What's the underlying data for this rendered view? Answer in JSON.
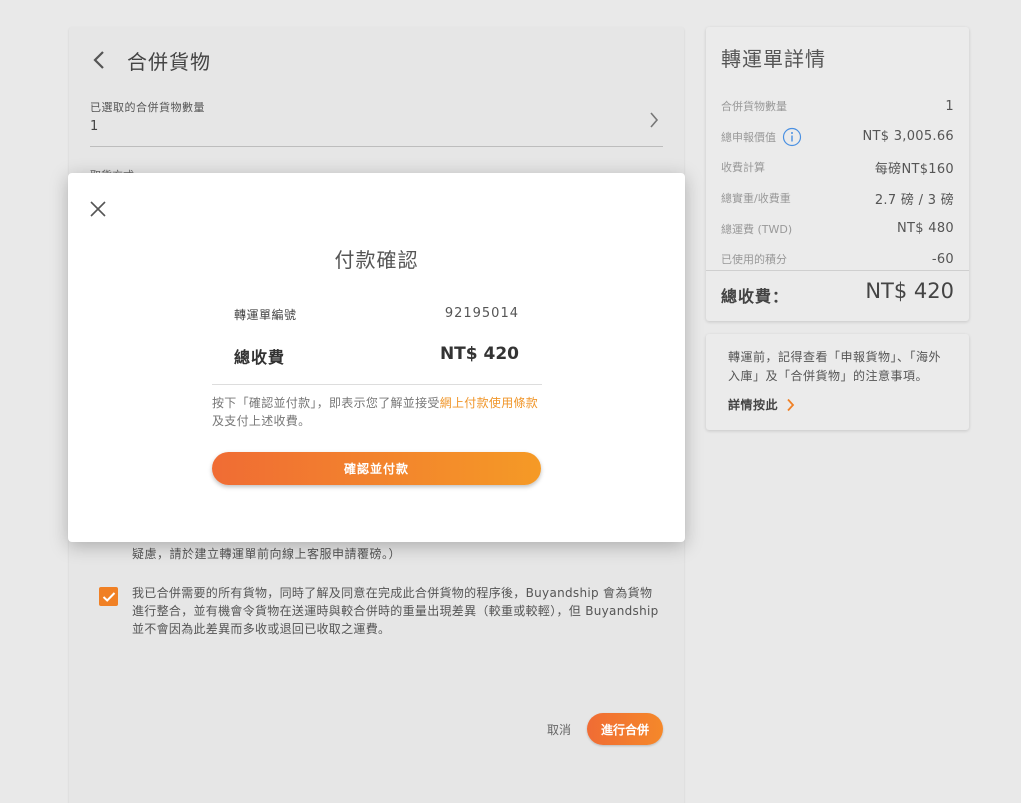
{
  "page": {
    "title": "合併貨物",
    "selected_label": "已選取的合併貨物數量",
    "selected_value": "1",
    "partial_label": "取貨方式",
    "notice_line": "疑慮，請於建立轉運單前向線上客服申請覆磅。）",
    "agree_text": "我已合併需要的所有貨物，同時了解及同意在完成此合併貨物的程序後，Buyandship 會為貨物進行整合，並有機會令貨物在送運時與較合併時的重量出現差異（較重或較輕），但 Buyandship 並不會因為此差異而多收或退回已收取之運費。",
    "agree_checked": true,
    "cancel_label": "取消",
    "merge_label": "進行合併"
  },
  "summary": {
    "title": "轉運單詳情",
    "rows": [
      {
        "label": "合併貨物數量",
        "value": "1"
      },
      {
        "label": "總申報價值",
        "value": "NT$ 3,005.66"
      },
      {
        "label": "收費計算",
        "value": "每磅NT$160"
      },
      {
        "label": "總實重/收費重",
        "value": "2.7 磅 / 3 磅"
      },
      {
        "label": "總運費 (TWD)",
        "value": "NT$ 480"
      },
      {
        "label": "已使用的積分",
        "value": "-60"
      }
    ],
    "total_label": "總收費：",
    "total_value": "NT$ 420"
  },
  "reminder": {
    "text": "轉運前，記得查看「申報貨物」、「海外入庫」及「合併貨物」的注意事項。",
    "link_label": "詳情按此"
  },
  "modal": {
    "title": "付款確認",
    "waybill_label": "轉運單編號",
    "waybill_value": "92195014",
    "total_label": "總收費",
    "total_value": "NT$ 420",
    "terms_prefix": "按下「確認並付款」，即表示您了解並接受",
    "terms_link": "網上付款使用條款",
    "terms_suffix": "及支付上述收費。",
    "confirm_label": "確認並付款"
  },
  "colors": {
    "accent": "#f08025",
    "link": "#f0962a",
    "info": "#4a90e2"
  }
}
